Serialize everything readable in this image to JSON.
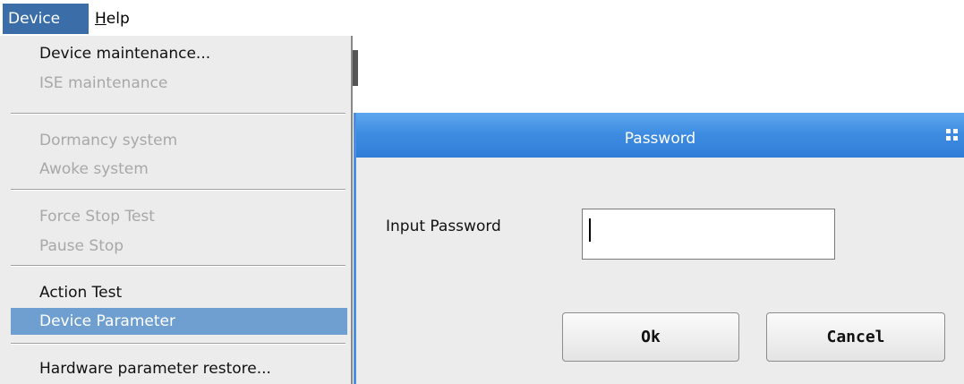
{
  "menubar": {
    "device": "Device",
    "help_first": "H",
    "help_rest": "elp"
  },
  "device_menu": {
    "items": [
      {
        "label": "Device maintenance...",
        "enabled": true
      },
      {
        "label": "ISE maintenance",
        "enabled": false
      },
      {
        "label": "Dormancy system",
        "enabled": false
      },
      {
        "label": "Awoke system",
        "enabled": false
      },
      {
        "label": "Force Stop Test",
        "enabled": false
      },
      {
        "label": "Pause Stop",
        "enabled": false
      },
      {
        "label": "Action Test",
        "enabled": true
      },
      {
        "label": "Device Parameter",
        "enabled": true,
        "selected": true
      },
      {
        "label": "Hardware parameter restore...",
        "enabled": true
      }
    ]
  },
  "dialog": {
    "title": "Password",
    "input_label": "Input Password",
    "input_value": "",
    "ok_label": "Ok",
    "cancel_label": "Cancel",
    "icon": "grid-icon"
  },
  "colors": {
    "menu_active": "#3b6ea8",
    "menu_selected": "#6f9fd0",
    "titlebar": "#3f8de2"
  }
}
